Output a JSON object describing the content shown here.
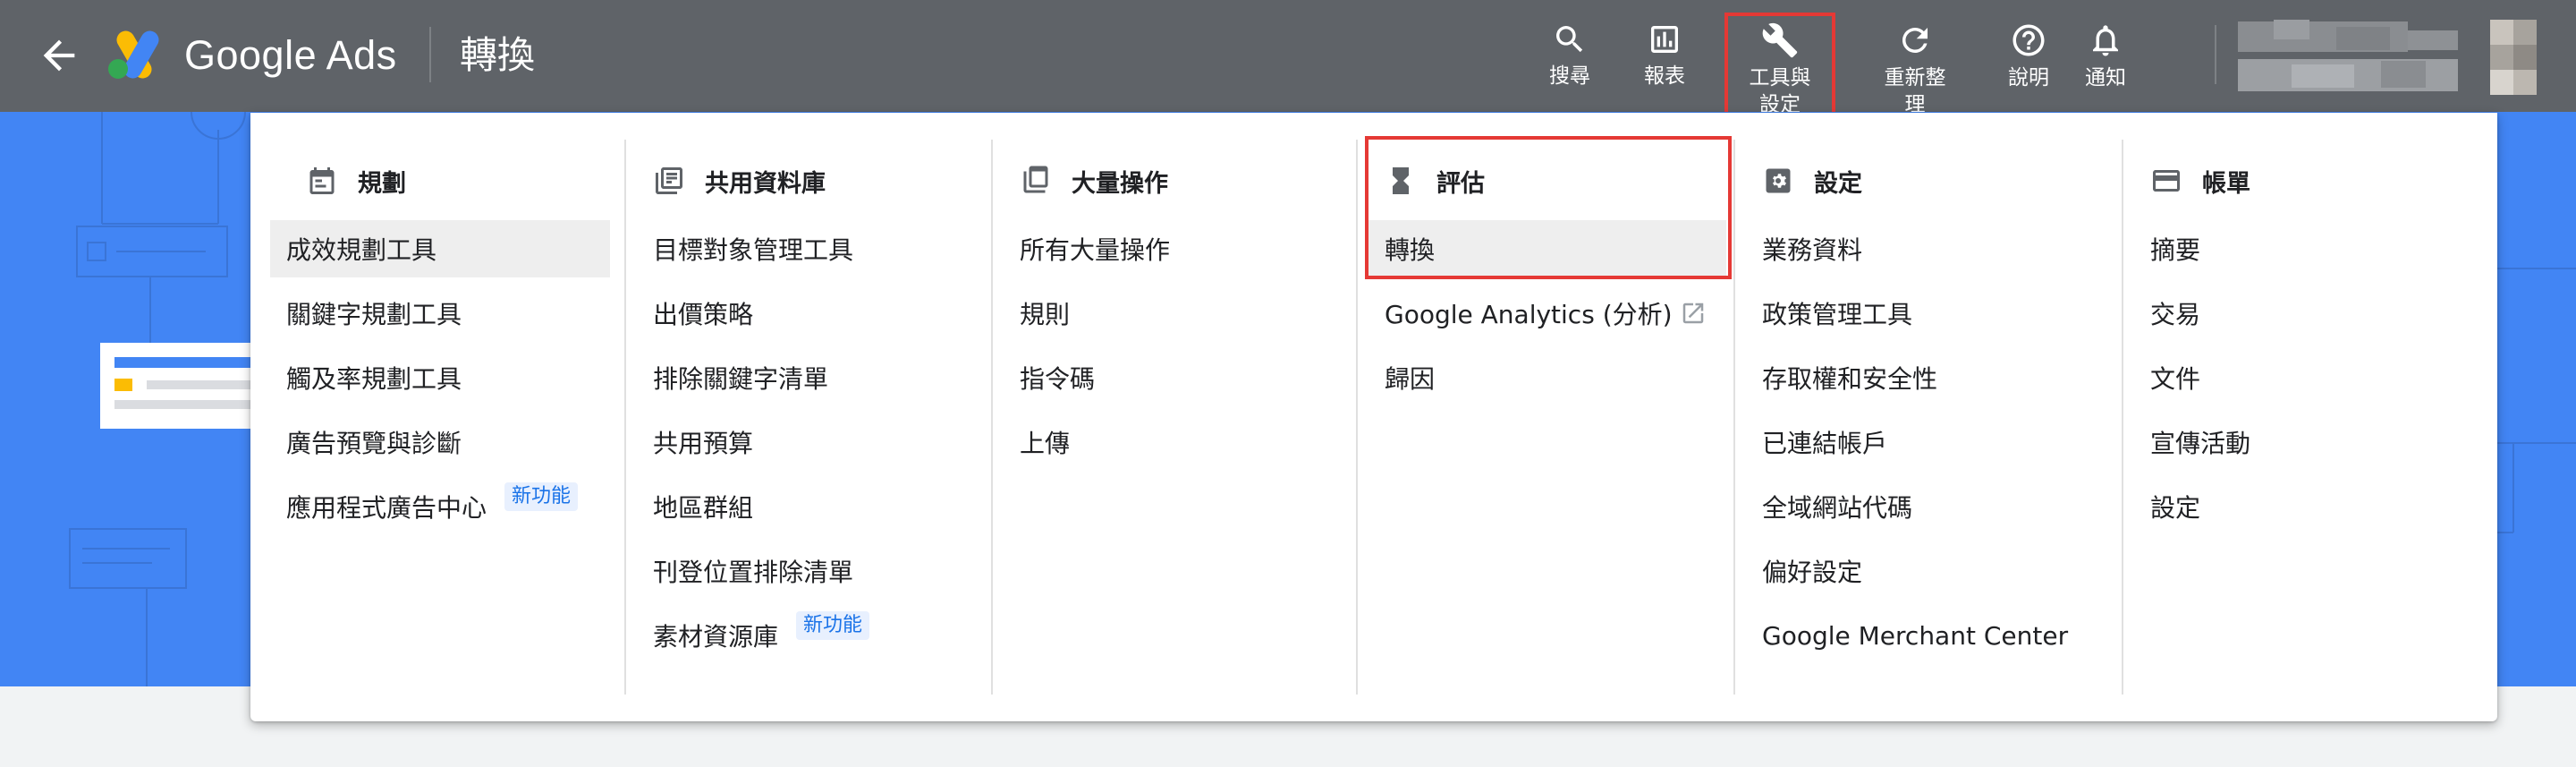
{
  "header": {
    "product": "Google Ads",
    "page_title": "轉換",
    "buttons": {
      "search": "搜尋",
      "reports": "報表",
      "tools": "工具與設定",
      "refresh": "重新整理",
      "help": "說明",
      "notifications": "通知"
    }
  },
  "colors": {
    "header_bg": "#5f6368",
    "background": "#4285f4",
    "highlight": "#e53935",
    "badge_text": "#1a73e8"
  },
  "menu": {
    "planning": {
      "title": "規劃",
      "icon": "calendar-icon",
      "items": [
        "成效規劃工具",
        "關鍵字規劃工具",
        "觸及率規劃工具",
        "廣告預覽與診斷",
        "應用程式廣告中心"
      ],
      "badge": "新功能"
    },
    "shared_library": {
      "title": "共用資料庫",
      "icon": "library-icon",
      "items": [
        "目標對象管理工具",
        "出價策略",
        "排除關鍵字清單",
        "共用預算",
        "地區群組",
        "刊登位置排除清單",
        "素材資源庫"
      ],
      "badge": "新功能"
    },
    "bulk_actions": {
      "title": "大量操作",
      "icon": "copy-stack-icon",
      "items": [
        "所有大量操作",
        "規則",
        "指令碼",
        "上傳"
      ]
    },
    "measurement": {
      "title": "評估",
      "icon": "hourglass-icon",
      "items": [
        "轉換",
        "Google Analytics (分析)",
        "歸因"
      ]
    },
    "setup": {
      "title": "設定",
      "icon": "settings-box-icon",
      "items": [
        "業務資料",
        "政策管理工具",
        "存取權和安全性",
        "已連結帳戶",
        "全域網站代碼",
        "偏好設定",
        "Google Merchant Center"
      ]
    },
    "billing": {
      "title": "帳單",
      "icon": "credit-card-icon",
      "items": [
        "摘要",
        "交易",
        "文件",
        "宣傳活動",
        "設定"
      ]
    }
  }
}
